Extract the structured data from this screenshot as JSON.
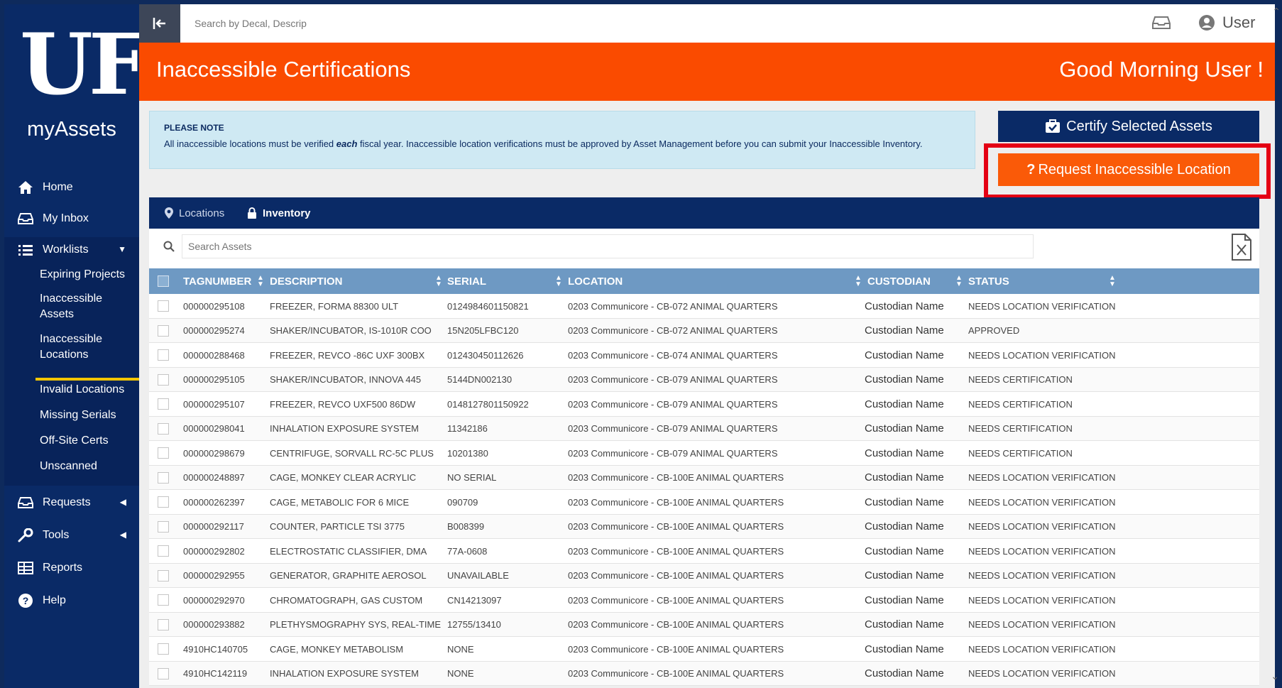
{
  "sidebar": {
    "logo": "UF",
    "app_name": "myAssets",
    "nav": [
      {
        "label": "Home",
        "icon": "home-icon"
      },
      {
        "label": "My Inbox",
        "icon": "inbox-icon"
      },
      {
        "label": "Worklists",
        "icon": "list-icon"
      },
      {
        "label": "Requests",
        "icon": "inbox-icon"
      },
      {
        "label": "Tools",
        "icon": "wrench-icon"
      },
      {
        "label": "Reports",
        "icon": "table-icon"
      },
      {
        "label": "Help",
        "icon": "question-icon"
      }
    ],
    "worklists_sub": [
      "Expiring Projects",
      "Inaccessible Assets",
      "Inaccessible Locations",
      "Invalid Locations",
      "Missing Serials",
      "Off-Site Certs",
      "Unscanned"
    ],
    "active_sub": "Inaccessible Locations"
  },
  "topbar": {
    "search_placeholder": "Search by Decal, Descrip",
    "user": "User"
  },
  "hero": {
    "title": "Inaccessible Certifications",
    "greeting": "Good Morning User !"
  },
  "note": {
    "title": "PLEASE NOTE",
    "text_before": "All inaccessible locations must be verified ",
    "text_emph": "each",
    "text_after": " fiscal year. Inaccessible location verifications must be approved by Asset Management before you can submit your Inaccessible Inventory."
  },
  "actions": {
    "certify": "Certify Selected Assets",
    "request": "Request Inaccessible Location"
  },
  "tabs": [
    {
      "label": "Locations",
      "active": false
    },
    {
      "label": "Inventory",
      "active": true
    }
  ],
  "asset_search_placeholder": "Search Assets",
  "table": {
    "headers": [
      "TAGNUMBER",
      "DESCRIPTION",
      "SERIAL",
      "LOCATION",
      "CUSTODIAN",
      "STATUS"
    ],
    "rows": [
      [
        "000000295108",
        "FREEZER, FORMA 88300 ULT",
        "0124984601150821",
        "0203 Communicore - CB-072 ANIMAL QUARTERS",
        "Custodian Name",
        "NEEDS LOCATION VERIFICATION"
      ],
      [
        "000000295274",
        "SHAKER/INCUBATOR, IS-1010R COO",
        "15N205LFBC120",
        "0203 Communicore - CB-072 ANIMAL QUARTERS",
        "Custodian Name",
        "APPROVED"
      ],
      [
        "000000288468",
        "FREEZER, REVCO -86C UXF 300BX",
        "012430450112626",
        "0203 Communicore - CB-074 ANIMAL QUARTERS",
        "Custodian Name",
        "NEEDS LOCATION VERIFICATION"
      ],
      [
        "000000295105",
        "SHAKER/INCUBATOR, INNOVA 445",
        "5144DN002130",
        "0203 Communicore - CB-079 ANIMAL QUARTERS",
        "Custodian Name",
        "NEEDS CERTIFICATION"
      ],
      [
        "000000295107",
        "FREEZER, REVCO UXF500 86DW",
        "0148127801150922",
        "0203 Communicore - CB-079 ANIMAL QUARTERS",
        "Custodian Name",
        "NEEDS CERTIFICATION"
      ],
      [
        "000000298041",
        "INHALATION EXPOSURE SYSTEM",
        "11342186",
        "0203 Communicore - CB-079 ANIMAL QUARTERS",
        "Custodian Name",
        "NEEDS CERTIFICATION"
      ],
      [
        "000000298679",
        "CENTRIFUGE, SORVALL RC-5C PLUS",
        "10201380",
        "0203 Communicore - CB-079 ANIMAL QUARTERS",
        "Custodian Name",
        "NEEDS CERTIFICATION"
      ],
      [
        "000000248897",
        "CAGE, MONKEY CLEAR ACRYLIC",
        "NO SERIAL",
        "0203 Communicore - CB-100E ANIMAL QUARTERS",
        "Custodian Name",
        "NEEDS LOCATION VERIFICATION"
      ],
      [
        "000000262397",
        "CAGE, METABOLIC FOR 6 MICE",
        "090709",
        "0203 Communicore - CB-100E ANIMAL QUARTERS",
        "Custodian Name",
        "NEEDS LOCATION VERIFICATION"
      ],
      [
        "000000292117",
        "COUNTER, PARTICLE TSI 3775",
        "B008399",
        "0203 Communicore - CB-100E ANIMAL QUARTERS",
        "Custodian Name",
        "NEEDS LOCATION VERIFICATION"
      ],
      [
        "000000292802",
        "ELECTROSTATIC CLASSIFIER, DMA",
        "77A-0608",
        "0203 Communicore - CB-100E ANIMAL QUARTERS",
        "Custodian Name",
        "NEEDS LOCATION VERIFICATION"
      ],
      [
        "000000292955",
        "GENERATOR, GRAPHITE AEROSOL",
        "UNAVAILABLE",
        "0203 Communicore - CB-100E ANIMAL QUARTERS",
        "Custodian Name",
        "NEEDS LOCATION VERIFICATION"
      ],
      [
        "000000292970",
        "CHROMATOGRAPH, GAS CUSTOM",
        "CN14213097",
        "0203 Communicore - CB-100E ANIMAL QUARTERS",
        "Custodian Name",
        "NEEDS LOCATION VERIFICATION"
      ],
      [
        "000000293882",
        "PLETHYSMOGRAPHY SYS, REAL-TIME",
        "12755/13410",
        "0203 Communicore - CB-100E ANIMAL QUARTERS",
        "Custodian Name",
        "NEEDS LOCATION VERIFICATION"
      ],
      [
        "4910HC140705",
        "CAGE, MONKEY METABOLISM",
        "NONE",
        "0203 Communicore - CB-100E ANIMAL QUARTERS",
        "Custodian Name",
        "NEEDS LOCATION VERIFICATION"
      ],
      [
        "4910HC142119",
        "INHALATION EXPOSURE SYSTEM",
        "NONE",
        "0203 Communicore - CB-100E ANIMAL QUARTERS",
        "Custodian Name",
        "NEEDS LOCATION VERIFICATION"
      ]
    ]
  },
  "colors": {
    "navy": "#0a2a66",
    "orange": "#fa4b00",
    "highlight": "#e40014",
    "table_header": "#6e99c3"
  }
}
